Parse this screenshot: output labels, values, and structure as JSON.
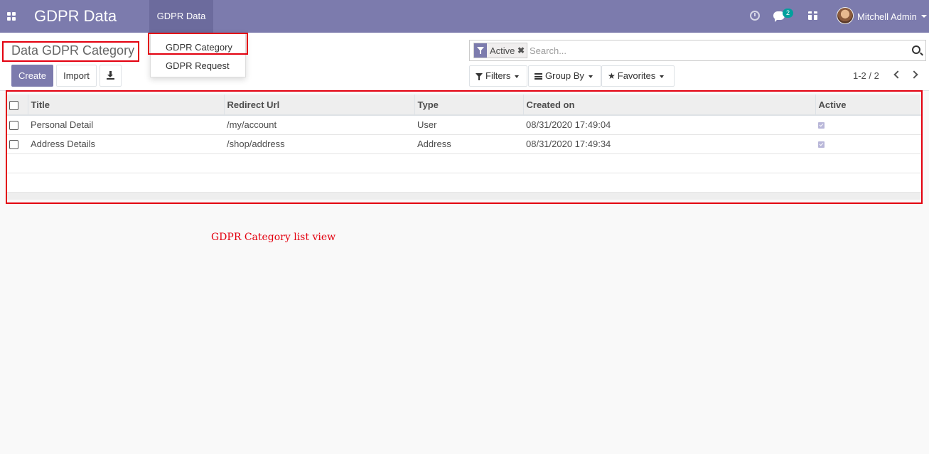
{
  "navbar": {
    "app_title": "GDPR Data",
    "menu_label": "GDPR Data",
    "chat_count": "2",
    "user_name": "Mitchell Admin"
  },
  "dropdown": {
    "items": [
      {
        "label": "GDPR Category"
      },
      {
        "label": "GDPR Request"
      }
    ]
  },
  "control_panel": {
    "breadcrumb": "Data GDPR Category",
    "create_label": "Create",
    "import_label": "Import",
    "search": {
      "facet_label": "Active",
      "facet_remove": "✖",
      "placeholder": "Search..."
    },
    "filters_label": "Filters",
    "groupby_label": "Group By",
    "favorites_label": "Favorites",
    "pager": "1-2 / 2"
  },
  "list": {
    "columns": [
      "Title",
      "Redirect Url",
      "Type",
      "Created on",
      "Active"
    ],
    "rows": [
      {
        "title": "Personal Detail",
        "url": "/my/account",
        "type": "User",
        "created": "08/31/2020 17:49:04",
        "active": true
      },
      {
        "title": "Address Details",
        "url": "/shop/address",
        "type": "Address",
        "created": "08/31/2020 17:49:34",
        "active": true
      }
    ]
  },
  "caption": "GDPR Category list view",
  "colors": {
    "navbar": "#7c7bad",
    "primary": "#7c7bad",
    "highlight_border": "#e3000f",
    "badge": "#00a09d"
  }
}
